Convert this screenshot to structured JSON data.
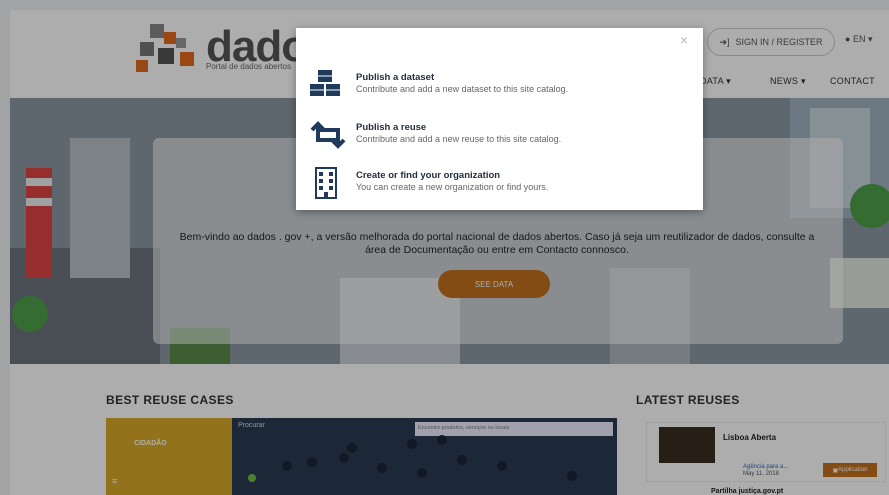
{
  "header": {
    "logo_text": "dados",
    "logo_subtitle": "Portal de dados abertos",
    "signin_label": "SIGN IN / REGISTER",
    "lang_label": "EN",
    "nav": [
      "DATA",
      "NEWS",
      "CONTACT"
    ]
  },
  "hero": {
    "welcome": "Bem-vindo ao dados . gov +, a versão melhorada do portal nacional de dados abertos. Caso já seja um reutilizador de dados, consulte a área de Documentação ou entre em Contacto connosco.",
    "button_label": "SEE DATA"
  },
  "sections": {
    "best_reuse": "BEST REUSE CASES",
    "latest_reuses": "LATEST REUSES",
    "best_card_logo": "CIDADÃO",
    "procurar": "Procurar",
    "search_placeholder": "Encontre produtos, serviços ou locais"
  },
  "reuses": [
    {
      "title": "Lisboa Aberta",
      "org": "Agência para a...",
      "date": "May 11, 2018",
      "badge": "Application"
    },
    {
      "title": "Partilha justiça.gov.pt"
    }
  ],
  "modal": {
    "close": "×",
    "options": [
      {
        "icon": "cubes-icon",
        "title": "Publish a dataset",
        "desc": "Contribute and add a new dataset to this site catalog."
      },
      {
        "icon": "retweet-icon",
        "title": "Publish a reuse",
        "desc": "Contribute and add a new reuse to this site catalog."
      },
      {
        "icon": "building-icon",
        "title": "Create or find your organization",
        "desc": "You can create a new organization or find yours."
      }
    ]
  },
  "colors": {
    "accent": "#c2701f",
    "icon": "#1f3a5a"
  }
}
